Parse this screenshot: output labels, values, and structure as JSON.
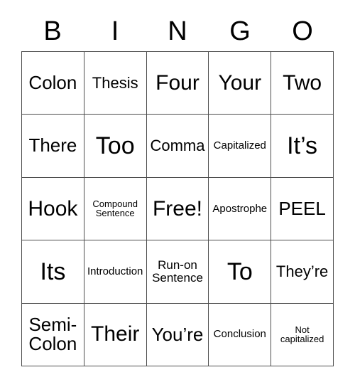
{
  "card": {
    "header": {
      "letters": [
        "B",
        "I",
        "N",
        "G",
        "O"
      ]
    },
    "grid": {
      "rows": 5,
      "columns": 5,
      "border_color": "#4d4d4d",
      "background_color": "#ffffff",
      "text_color": "#000000",
      "cells": [
        {
          "text": "Colon",
          "size": "lg"
        },
        {
          "text": "Thesis",
          "size": "md"
        },
        {
          "text": "Four",
          "size": "xl"
        },
        {
          "text": "Your",
          "size": "xl"
        },
        {
          "text": "Two",
          "size": "xl"
        },
        {
          "text": "There",
          "size": "lg"
        },
        {
          "text": "Too",
          "size": "xxl"
        },
        {
          "text": "Comma",
          "size": "md"
        },
        {
          "text": "Capitalized",
          "size": "xs"
        },
        {
          "text": "It’s",
          "size": "xxl"
        },
        {
          "text": "Hook",
          "size": "xl"
        },
        {
          "text": "Compound\nSentence",
          "size": "xxs"
        },
        {
          "text": "Free!",
          "size": "xl"
        },
        {
          "text": "Apostrophe",
          "size": "xs"
        },
        {
          "text": "PEEL",
          "size": "lg"
        },
        {
          "text": "Its",
          "size": "xxl"
        },
        {
          "text": "Introduction",
          "size": "xs"
        },
        {
          "text": "Run-on\nSentence",
          "size": "sm"
        },
        {
          "text": "To",
          "size": "xxl"
        },
        {
          "text": "They’re",
          "size": "md"
        },
        {
          "text": "Semi-\nColon",
          "size": "lg"
        },
        {
          "text": "Their",
          "size": "xl"
        },
        {
          "text": "You’re",
          "size": "lg"
        },
        {
          "text": "Conclusion",
          "size": "xs"
        },
        {
          "text": "Not\ncapitalized",
          "size": "xxs"
        }
      ]
    }
  }
}
